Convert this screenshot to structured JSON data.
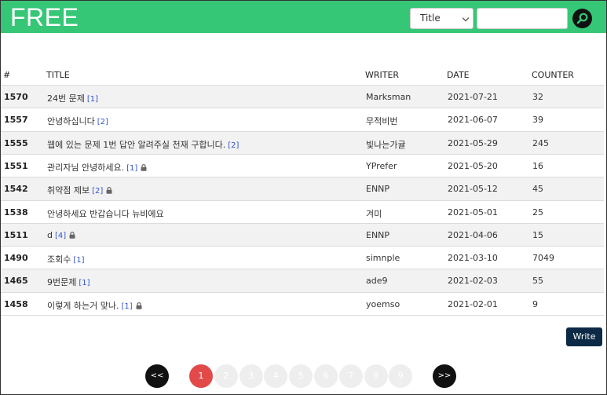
{
  "header": {
    "logo": "FREE",
    "search_option": "Title",
    "search_placeholder": ""
  },
  "table": {
    "columns": [
      "#",
      "TITLE",
      "WRITER",
      "DATE",
      "COUNTER"
    ],
    "rows": [
      {
        "num": "1570",
        "title": "24번 문제",
        "comments": "[1]",
        "locked": false,
        "writer": "Marksman",
        "date": "2021-07-21",
        "counter": "32"
      },
      {
        "num": "1557",
        "title": "안녕하십니다",
        "comments": "[2]",
        "locked": false,
        "writer": "무적비번",
        "date": "2021-06-07",
        "counter": "39"
      },
      {
        "num": "1555",
        "title": "웹에 있는 문제 1번 답안 알려주실 천재 구합니다.",
        "comments": "[2]",
        "locked": false,
        "writer": "빛나는가귤",
        "date": "2021-05-29",
        "counter": "245"
      },
      {
        "num": "1551",
        "title": "관리자님 안녕하세요.",
        "comments": "[1]",
        "locked": true,
        "writer": "YPrefer",
        "date": "2021-05-20",
        "counter": "16"
      },
      {
        "num": "1542",
        "title": "취약점 제보",
        "comments": "[2]",
        "locked": true,
        "writer": "ENNP",
        "date": "2021-05-12",
        "counter": "45"
      },
      {
        "num": "1538",
        "title": "안녕하세요 반갑습니다 뉴비에요",
        "comments": "",
        "locked": false,
        "writer": "겨미",
        "date": "2021-05-01",
        "counter": "25"
      },
      {
        "num": "1511",
        "title": "d",
        "comments": "[4]",
        "locked": true,
        "writer": "ENNP",
        "date": "2021-04-06",
        "counter": "15"
      },
      {
        "num": "1490",
        "title": "조회수",
        "comments": "[1]",
        "locked": false,
        "writer": "simnple",
        "date": "2021-03-10",
        "counter": "7049"
      },
      {
        "num": "1465",
        "title": "9번문제",
        "comments": "[1]",
        "locked": false,
        "writer": "ade9",
        "date": "2021-02-03",
        "counter": "55"
      },
      {
        "num": "1458",
        "title": "이렇게 하는거 맞나.",
        "comments": "[1]",
        "locked": true,
        "writer": "yoemso",
        "date": "2021-02-01",
        "counter": "9"
      }
    ]
  },
  "write_label": "Write",
  "pagination": {
    "prev": "<<",
    "next": ">>",
    "pages": [
      "1",
      "2",
      "3",
      "4",
      "5",
      "6",
      "7",
      "8",
      "9"
    ],
    "current": "1"
  },
  "colors": {
    "header": "#36c776",
    "active_page": "#e24a4a",
    "write_button": "#0c2a45",
    "comment_link": "#3355cc"
  }
}
